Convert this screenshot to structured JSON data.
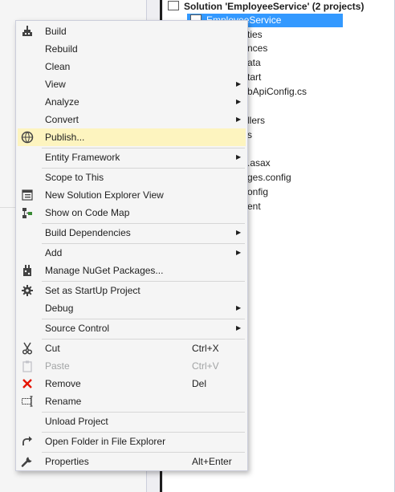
{
  "solution_explorer": {
    "solution_title": "Solution 'EmployeeService' (2 projects)",
    "project_name": "EmployeeService",
    "items": [
      "ties",
      "nces",
      "ata",
      "tart",
      "bApiConfig.cs",
      "llers",
      "s",
      ".asax",
      "ges.config",
      "onfig",
      "ent"
    ]
  },
  "menu": {
    "build": "Build",
    "rebuild": "Rebuild",
    "clean": "Clean",
    "view": "View",
    "analyze": "Analyze",
    "convert": "Convert",
    "publish": "Publish...",
    "entity_framework": "Entity Framework",
    "scope_to_this": "Scope to This",
    "new_solution_explorer_view": "New Solution Explorer View",
    "show_on_code_map": "Show on Code Map",
    "build_dependencies": "Build Dependencies",
    "add": "Add",
    "manage_nuget": "Manage NuGet Packages...",
    "set_startup": "Set as StartUp Project",
    "debug": "Debug",
    "source_control": "Source Control",
    "cut": "Cut",
    "cut_shortcut": "Ctrl+X",
    "paste": "Paste",
    "paste_shortcut": "Ctrl+V",
    "remove": "Remove",
    "remove_shortcut": "Del",
    "rename": "Rename",
    "unload_project": "Unload Project",
    "open_folder": "Open Folder in File Explorer",
    "properties": "Properties",
    "properties_shortcut": "Alt+Enter"
  },
  "icons": {
    "build": "build-icon",
    "publish": "publish-icon",
    "new_view": "solution-view-icon",
    "code_map": "code-map-icon",
    "nuget": "nuget-icon",
    "startup": "gear-icon",
    "cut": "scissors-icon",
    "paste": "clipboard-icon",
    "remove": "red-x-icon",
    "rename": "rename-icon",
    "open_folder": "open-arrow-icon",
    "properties": "wrench-icon",
    "submenu": "chevron-right-icon"
  },
  "colors": {
    "highlight": "#fdf4bf",
    "selection": "#3399ff",
    "remove_red": "#e51400"
  }
}
